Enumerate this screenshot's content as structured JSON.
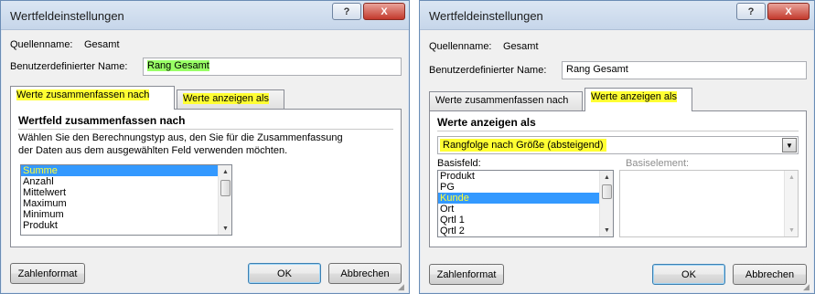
{
  "left": {
    "title": "Wertfeldeinstellungen",
    "help_btn": "?",
    "close_btn": "X",
    "source_label": "Quellenname:",
    "source_value": "Gesamt",
    "custom_name_label": "Benutzerdefinierter Name:",
    "custom_name_value": "Rang Gesamt",
    "tabs": [
      "Werte zusammenfassen nach",
      "Werte anzeigen als"
    ],
    "section_title": "Wertfeld zusammenfassen nach",
    "description_line1": "Wählen Sie den Berechnungstyp aus, den Sie für die Zusammenfassung",
    "description_line2": "der Daten aus dem ausgewählten Feld verwenden möchten.",
    "list_items": [
      "Summe",
      "Anzahl",
      "Mittelwert",
      "Maximum",
      "Minimum",
      "Produkt"
    ],
    "selected_item": "Summe",
    "number_format_btn": "Zahlenformat",
    "ok_btn": "OK",
    "cancel_btn": "Abbrechen"
  },
  "right": {
    "title": "Wertfeldeinstellungen",
    "help_btn": "?",
    "close_btn": "X",
    "source_label": "Quellenname:",
    "source_value": "Gesamt",
    "custom_name_label": "Benutzerdefinierter Name:",
    "custom_name_value": "Rang Gesamt",
    "tabs": [
      "Werte zusammenfassen nach",
      "Werte anzeigen als"
    ],
    "section_title": "Werte anzeigen als",
    "dropdown_value": "Rangfolge nach Größe (absteigend)",
    "base_field_label": "Basisfeld:",
    "base_element_label": "Basiselement:",
    "base_field_items": [
      "Produkt",
      "PG",
      "Kunde",
      "Ort",
      "Qrtl 1",
      "Qrtl 2"
    ],
    "selected_item": "Kunde",
    "number_format_btn": "Zahlenformat",
    "ok_btn": "OK",
    "cancel_btn": "Abbrechen"
  },
  "colors": {
    "highlight_yellow": "#ffff33",
    "highlight_green": "#99ff66",
    "selection_blue": "#3399ff"
  }
}
